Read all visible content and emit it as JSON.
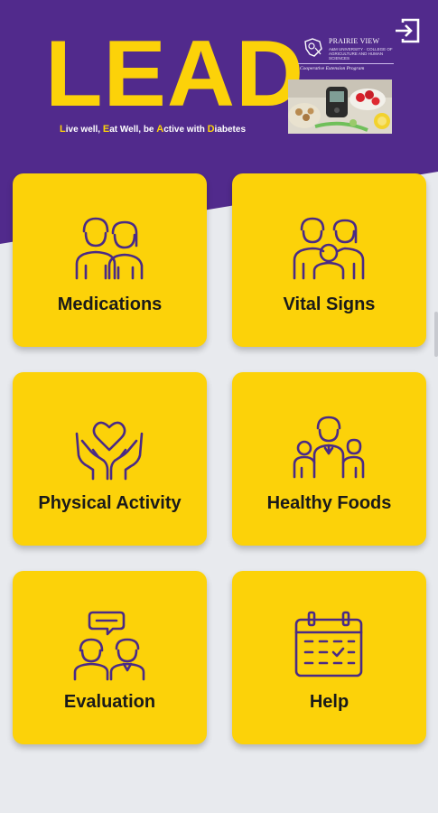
{
  "header": {
    "title": "LEAD",
    "tagline": [
      {
        "hl": "L",
        "rest": "ive well, "
      },
      {
        "hl": "E",
        "rest": "at Well, be "
      },
      {
        "hl": "A",
        "rest": "ctive with "
      },
      {
        "hl": "D",
        "rest": "iabetes"
      }
    ],
    "exit_icon": "logout-icon",
    "partner": {
      "name": "PRAIRIE VIEW",
      "sub": "A&M UNIVERSITY · COLLEGE OF AGRICULTURE AND HUMAN SCIENCES",
      "program": "Cooperative Extension Program"
    }
  },
  "menu": [
    {
      "label": "Medications",
      "icon": "family-icon"
    },
    {
      "label": "Vital Signs",
      "icon": "family-group-icon"
    },
    {
      "label": "Physical Activity",
      "icon": "heart-hands-icon"
    },
    {
      "label": "Healthy Foods",
      "icon": "people-group-icon"
    },
    {
      "label": "Evaluation",
      "icon": "conversation-icon"
    },
    {
      "label": "Help",
      "icon": "calendar-icon"
    }
  ],
  "colors": {
    "purple": "#512a8c",
    "yellow": "#fcd209",
    "icon_stroke": "#4a2a86",
    "background": "#e8eaee"
  }
}
